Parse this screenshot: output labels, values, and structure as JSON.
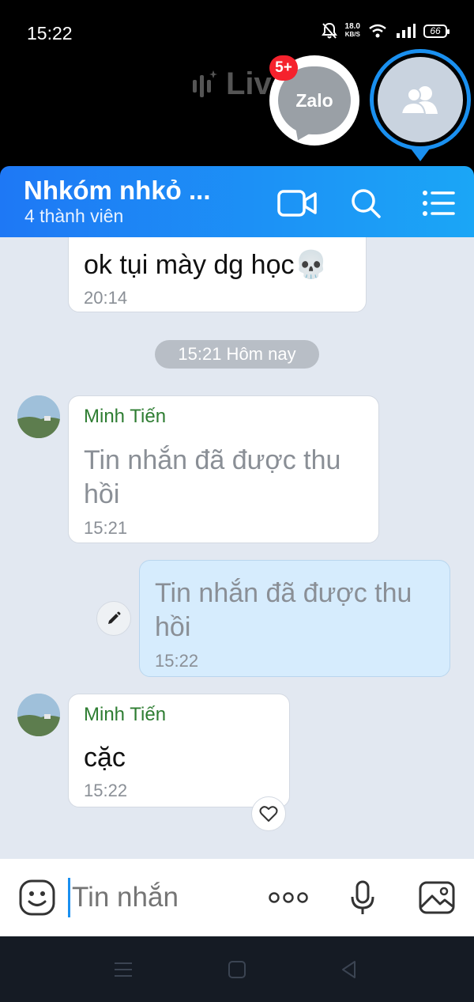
{
  "status_bar": {
    "time": "15:22",
    "net_speed_value": "18.0",
    "net_speed_unit": "KB/S",
    "battery": "66"
  },
  "overlay": {
    "live_label": "Liv",
    "zalo_label": "Zalo",
    "zalo_badge": "5+"
  },
  "header": {
    "title": "Nhkóm nhkỏ ...",
    "subtitle": "4 thành viên"
  },
  "chat": {
    "messages": [
      {
        "sender": "",
        "text": "ok tụi mày dg học💀",
        "time": "20:14",
        "mine": false
      },
      {
        "sender": "Minh Tiến",
        "text_line1": "Tin nhắn đã được thu",
        "text_line2": "hồi",
        "time": "15:21",
        "mine": false
      },
      {
        "sender": "",
        "text_line1": "Tin nhắn đã được thu",
        "text_line2": "hồi",
        "time": "15:22",
        "mine": true
      },
      {
        "sender": "Minh Tiến",
        "text": "cặc",
        "time": "15:22",
        "mine": false
      }
    ],
    "date_separator": "15:21 Hôm nay"
  },
  "input": {
    "placeholder": "Tin nhắn"
  },
  "colors": {
    "header_start": "#1e78f5",
    "header_end": "#1ba6f6",
    "chat_bg": "#e2e8f1",
    "my_bubble": "#d6ecfd",
    "sender_name": "#2e7d32"
  }
}
